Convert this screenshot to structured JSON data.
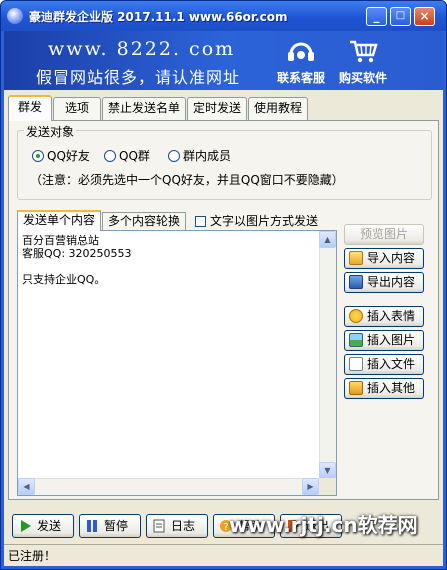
{
  "window": {
    "title": "豪迪群发企业版 2017.11.1 www.66or.com",
    "controls": {
      "minimize": "_",
      "maximize": "□",
      "close": "×"
    }
  },
  "banner": {
    "url": "www. 8222. com",
    "slogan": "假冒网站很多，请认准网址",
    "buttons": [
      {
        "label": "联系客服",
        "icon": "headset-icon"
      },
      {
        "label": "购买软件",
        "icon": "cart-icon"
      }
    ]
  },
  "tabs": [
    "群发",
    "选项",
    "禁止发送名单",
    "定时发送",
    "使用教程"
  ],
  "target_group": {
    "legend": "发送对象",
    "options": [
      {
        "label": "QQ好友",
        "selected": true
      },
      {
        "label": "QQ群",
        "selected": false
      },
      {
        "label": "群内成员",
        "selected": false
      }
    ],
    "note": "（注意：必须先选中一个QQ好友，并且QQ窗口不要隐藏）"
  },
  "content_tabs": [
    "发送单个内容",
    "多个内容轮换"
  ],
  "image_mode_checkbox": {
    "label": "文字以图片方式发送",
    "checked": false
  },
  "editor": {
    "text": "百分百营销总站\n客服QQ: 320250553\n\n只支持企业QQ。"
  },
  "side_buttons": [
    {
      "label": "预览图片",
      "enabled": false,
      "icon": ""
    },
    {
      "label": "导入内容",
      "enabled": true,
      "icon": "folder-open-icon"
    },
    {
      "label": "导出内容",
      "enabled": true,
      "icon": "save-disk-icon"
    },
    {
      "label": "插入表情",
      "enabled": true,
      "icon": "smiley-icon"
    },
    {
      "label": "插入图片",
      "enabled": true,
      "icon": "picture-icon"
    },
    {
      "label": "插入文件",
      "enabled": true,
      "icon": "file-icon"
    },
    {
      "label": "插入其他",
      "enabled": true,
      "icon": "insert-arrow-icon"
    }
  ],
  "action_buttons": [
    {
      "label": "发送",
      "icon": "play-icon"
    },
    {
      "label": "暂停",
      "icon": "pause-icon"
    },
    {
      "label": "日志",
      "icon": "log-icon"
    },
    {
      "label": "帮助",
      "icon": "help-icon"
    },
    {
      "label": "退出",
      "icon": "exit-icon"
    }
  ],
  "status": "已注册！",
  "watermark": "www.rjtj.cn软荐网",
  "colors": {
    "title_blue": "#2d5fd6",
    "tab_highlight": "#f0b93a",
    "face": "#ece9d8"
  }
}
